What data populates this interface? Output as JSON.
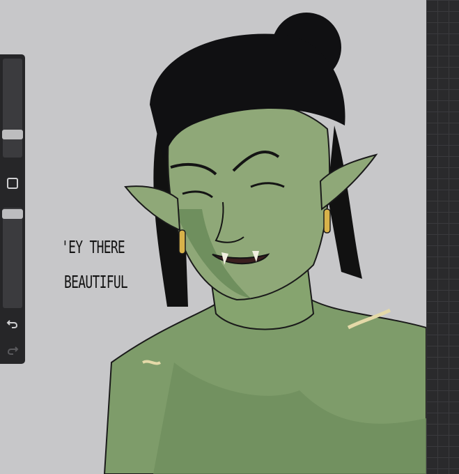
{
  "canvas": {
    "caption": {
      "line1": "'EY THERE",
      "line2": "BEAUTIFUL"
    },
    "subject": "green-skinned orc with topknot and gold earrings"
  },
  "sidebar": {
    "size_slider_level": 0.78,
    "opacity_slider_level": 0.95,
    "icons": [
      "modify-square-icon",
      "undo-icon",
      "redo-icon"
    ]
  },
  "colors": {
    "canvas_bg": "#c7c7c9",
    "skin": "#8fa878",
    "skin_shadow": "#6f8f5e",
    "hair": "#101012",
    "gold": "#d8b24a",
    "toolbar": "#262628",
    "panel": "#2a2a2c"
  }
}
